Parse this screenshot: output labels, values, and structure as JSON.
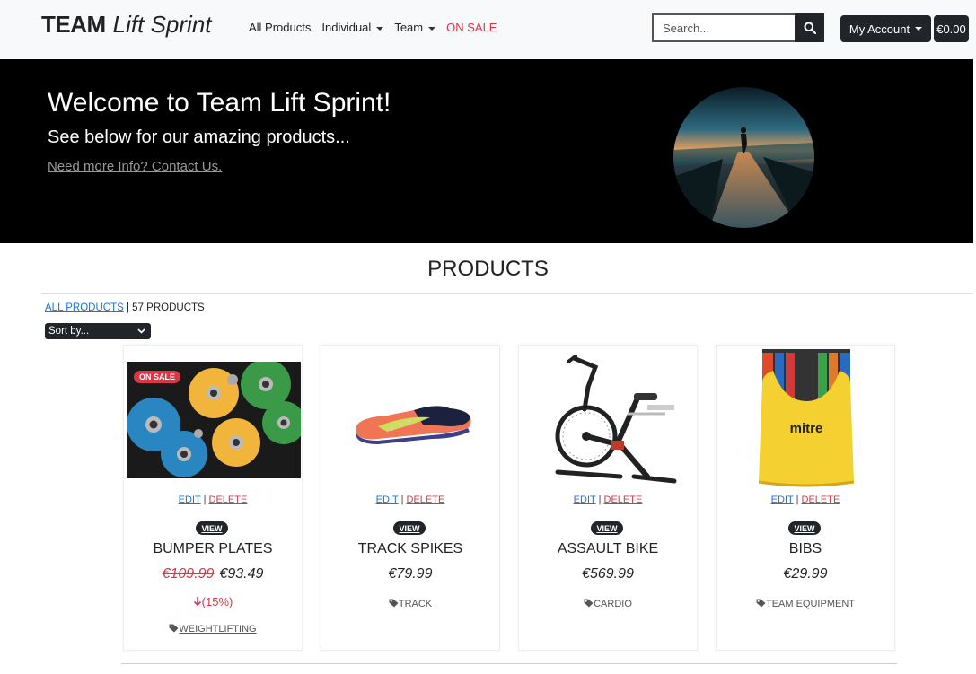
{
  "brand": {
    "bold": "TEAM",
    "italic": "Lift Sprint"
  },
  "nav": {
    "all_products": "All Products",
    "individual": "Individual",
    "team": "Team",
    "on_sale": "ON SALE"
  },
  "search": {
    "placeholder": "Search..."
  },
  "account": {
    "label": "My Account"
  },
  "cart": {
    "total": "€0.00"
  },
  "hero": {
    "title": "Welcome to Team Lift Sprint!",
    "subtitle": "See below for our amazing products...",
    "link": "Need more Info? Contact Us."
  },
  "products_header": {
    "title": "PRODUCTS",
    "crumb_link": "ALL PRODUCTS",
    "count": "57 PRODUCTS",
    "sort_label": "Sort by..."
  },
  "labels": {
    "edit": "EDIT",
    "delete": "DELETE",
    "view": "VIEW",
    "sep": "|"
  },
  "products": [
    {
      "name": "BUMPER PLATES",
      "old_price": "€109.99",
      "price": "€93.49",
      "discount": "(15%)",
      "badge": "ON SALE",
      "category": "WEIGHTLIFTING"
    },
    {
      "name": "TRACK SPIKES",
      "price": "€79.99",
      "category": "TRACK"
    },
    {
      "name": "ASSAULT BIKE",
      "price": "€569.99",
      "category": "CARDIO"
    },
    {
      "name": "BIBS",
      "price": "€29.99",
      "category": "TEAM EQUIPMENT"
    }
  ],
  "colors": {
    "dark": "#212529",
    "sale_red": "#dc3545",
    "link_blue": "#1a73e8",
    "hero_bg": "#000000"
  },
  "icons": [
    "search-icon",
    "tag-icon",
    "arrow-down-icon",
    "caret-down-icon",
    "chevron-down-icon"
  ]
}
